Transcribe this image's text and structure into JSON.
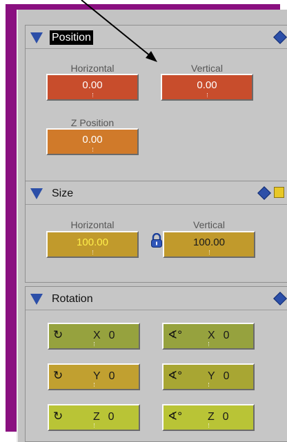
{
  "position": {
    "title": "Position",
    "horizontal": {
      "label": "Horizontal",
      "value": "0.00"
    },
    "vertical": {
      "label": "Vertical",
      "value": "0.00"
    },
    "z": {
      "label": "Z Position",
      "value": "0.00"
    }
  },
  "size": {
    "title": "Size",
    "horizontal": {
      "label": "Horizontal",
      "value": "100.00"
    },
    "vertical": {
      "label": "Vertical",
      "value": "100.00"
    }
  },
  "rotation": {
    "title": "Rotation",
    "rx": {
      "axis": "X",
      "value": "0"
    },
    "ry": {
      "axis": "Y",
      "value": "0"
    },
    "rz": {
      "axis": "Z",
      "value": "0"
    },
    "sx": {
      "axis": "X",
      "value": "0"
    },
    "sy": {
      "axis": "Y",
      "value": "0"
    },
    "sz": {
      "axis": "Z",
      "value": "0"
    }
  },
  "icons": {
    "collapse": "triangle-down-icon",
    "keyframe": "diamond-icon",
    "keyframe_square": "square-icon",
    "lock": "lock-icon",
    "rotate": "rotate-icon",
    "skew": "skew-icon"
  },
  "colors": {
    "frame": "#8a1080",
    "panel": "#c3c3c3",
    "accent_blue": "#2c4fa8",
    "field_red": "#c84d2c",
    "field_orange": "#d07a2a",
    "field_gold": "#c19a2c",
    "field_olive": "#96a23e",
    "field_lime": "#b9c436"
  }
}
